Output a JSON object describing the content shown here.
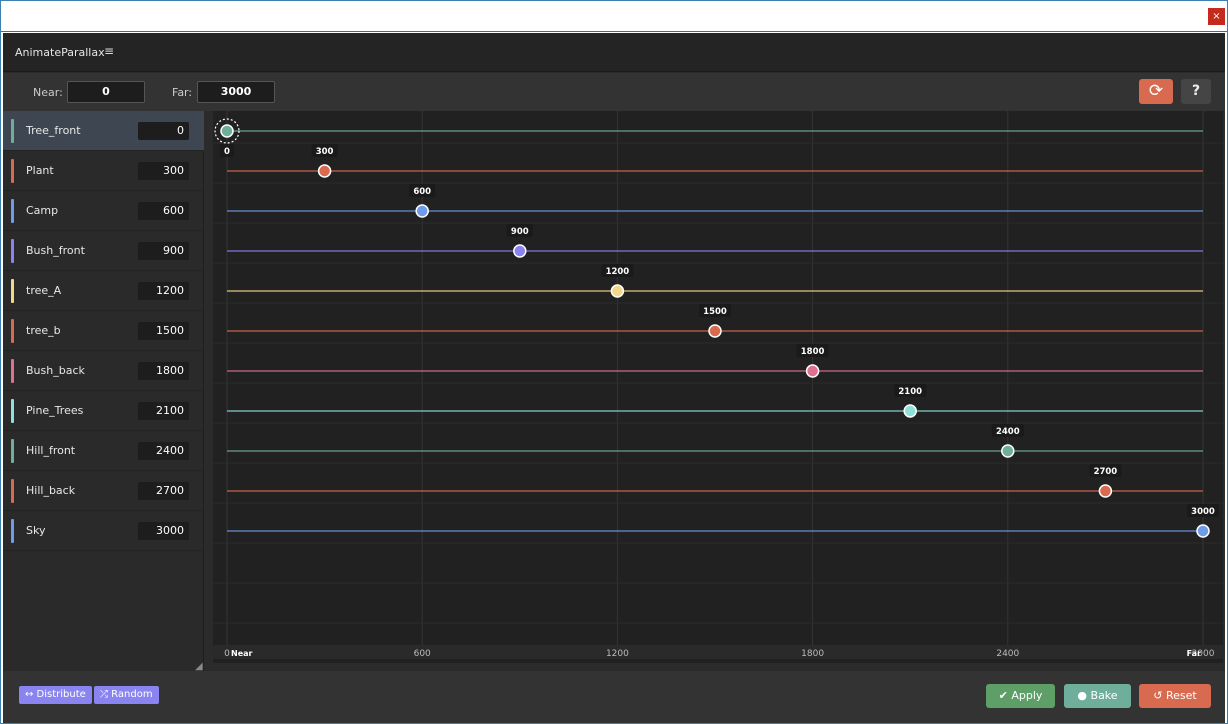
{
  "window": {
    "close_glyph": "×"
  },
  "header": {
    "title": "AnimateParallax",
    "menu_icon": "menu-icon",
    "menu_glyph": "≡"
  },
  "toolbar": {
    "near_label": "Near:",
    "near_value": "0",
    "far_label": "Far:",
    "far_value": "3000",
    "sync_icon": "refresh-icon",
    "sync_glyph": "⟳",
    "help_glyph": "?"
  },
  "layers": [
    {
      "name": "Tree_front",
      "value": "0",
      "color": "#6fae9b"
    },
    {
      "name": "Plant",
      "value": "300",
      "color": "#d86b4f"
    },
    {
      "name": "Camp",
      "value": "600",
      "color": "#6f9ce8"
    },
    {
      "name": "Bush_front",
      "value": "900",
      "color": "#8a84f0"
    },
    {
      "name": "tree_A",
      "value": "1200",
      "color": "#f4d88a"
    },
    {
      "name": "tree_b",
      "value": "1500",
      "color": "#d86b4f"
    },
    {
      "name": "Bush_back",
      "value": "1800",
      "color": "#e0708f"
    },
    {
      "name": "Pine_Trees",
      "value": "2100",
      "color": "#8ee0d8"
    },
    {
      "name": "Hill_front",
      "value": "2400",
      "color": "#6fae9b"
    },
    {
      "name": "Hill_back",
      "value": "2700",
      "color": "#d86b4f"
    },
    {
      "name": "Sky",
      "value": "3000",
      "color": "#6f9ce8"
    }
  ],
  "chart_data": {
    "type": "scatter",
    "xlim": [
      0,
      3000
    ],
    "x_ticks": [
      "0",
      "600",
      "1200",
      "1800",
      "2400",
      "3000"
    ],
    "near_label": "Near",
    "far_label": "Far",
    "grid": true,
    "series": [
      {
        "name": "Tree_front",
        "x": 0,
        "label": "0"
      },
      {
        "name": "Plant",
        "x": 300,
        "label": "300"
      },
      {
        "name": "Camp",
        "x": 600,
        "label": "600"
      },
      {
        "name": "Bush_front",
        "x": 900,
        "label": "900"
      },
      {
        "name": "tree_A",
        "x": 1200,
        "label": "1200"
      },
      {
        "name": "tree_b",
        "x": 1500,
        "label": "1500"
      },
      {
        "name": "Bush_back",
        "x": 1800,
        "label": "1800"
      },
      {
        "name": "Pine_Trees",
        "x": 2100,
        "label": "2100"
      },
      {
        "name": "Hill_front",
        "x": 2400,
        "label": "2400"
      },
      {
        "name": "Hill_back",
        "x": 2700,
        "label": "2700"
      },
      {
        "name": "Sky",
        "x": 3000,
        "label": "3000"
      }
    ]
  },
  "footer": {
    "distribute_label": "↔ Distribute",
    "random_label": "⤮ Random",
    "apply_label": "✔ Apply",
    "bake_label": "● Bake",
    "reset_label": "↺ Reset"
  },
  "colors": {
    "apply": "#5e9f68",
    "bake": "#6fae9b",
    "reset": "#d86b4f",
    "accent": "#8a84f0"
  }
}
